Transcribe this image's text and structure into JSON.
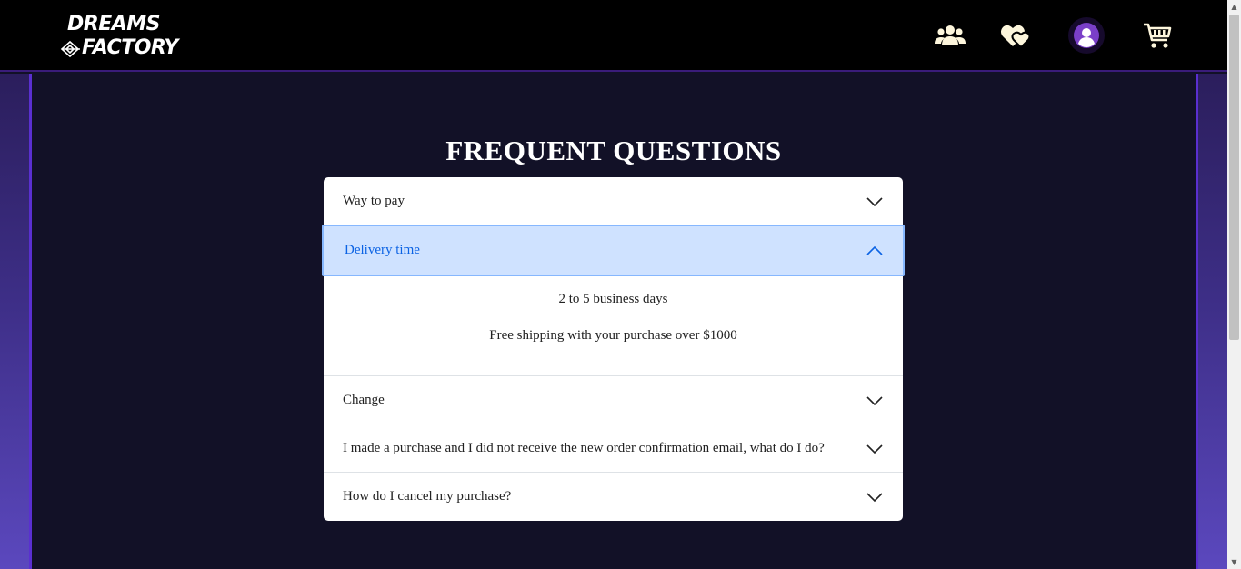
{
  "header": {
    "logo": {
      "line1": "DREAMS",
      "line2": "FACTORY"
    },
    "icons": {
      "users": "users-icon",
      "favorites": "hearts-icon",
      "account": "user-avatar-icon",
      "cart": "cart-icon"
    }
  },
  "page": {
    "title": "FREQUENT QUESTIONS"
  },
  "faq": {
    "items": [
      {
        "question": "Way to pay",
        "expanded": false
      },
      {
        "question": "Delivery time",
        "expanded": true,
        "answer": [
          "2 to 5 business days",
          "Free shipping with your purchase over $1000"
        ]
      },
      {
        "question": "Change",
        "expanded": false
      },
      {
        "question": "I made a purchase and I did not receive the new order confirmation email, what do I do?",
        "expanded": false
      },
      {
        "question": "How do I cancel my purchase?",
        "expanded": false
      }
    ]
  },
  "colors": {
    "header_bg": "#000000",
    "page_bg": "#121127",
    "accent_purple": "#5a2fd0",
    "active_item_bg": "#cfe2ff",
    "active_item_text": "#0c63e4",
    "icon_cream": "#fdf6dc"
  }
}
